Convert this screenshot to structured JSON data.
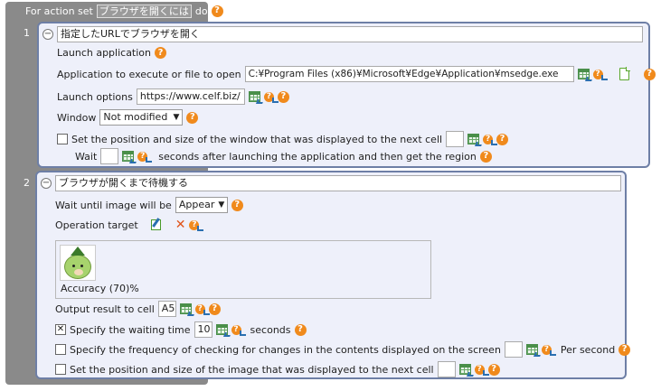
{
  "header": {
    "prefix": "For action set",
    "action_name": "ブラウザを開くには",
    "suffix": "do"
  },
  "step1": {
    "number": "1",
    "title": "指定したURLでブラウザを開く",
    "heading": "Launch application",
    "app_label": "Application to execute or file to open",
    "app_value": "C:¥Program Files (x86)¥Microsoft¥Edge¥Application¥msedge.exe",
    "options_label": "Launch options",
    "options_value": "https://www.celf.biz/",
    "window_label": "Window",
    "window_value": "Not modified",
    "set_position_label": "Set the position and size of the window that was displayed to the next cell",
    "wait_label": "Wait",
    "wait_suffix": "seconds after launching the application and then get the region"
  },
  "step2": {
    "number": "2",
    "title": "ブラウザが開くまで待機する",
    "wait_until_label": "Wait until image will be",
    "wait_until_value": "Appear",
    "operation_target_label": "Operation target",
    "accuracy_label": "Accuracy (70)%",
    "output_label": "Output result to cell",
    "output_value": "A5",
    "waiting_time_label": "Specify the waiting time",
    "waiting_time_value": "10",
    "waiting_time_unit": "seconds",
    "frequency_label": "Specify the frequency of checking for changes in the contents displayed on the screen",
    "frequency_unit": "Per second",
    "set_image_position_label": "Set the position and size of the image that was displayed to the next cell"
  },
  "help_glyph": "?",
  "icons": {
    "collapse": "minus-circle-icon",
    "cell_select": "spreadsheet-cell-icon",
    "help": "help-icon",
    "file": "file-browse-icon",
    "edit": "edit-image-icon",
    "delete": "delete-icon"
  },
  "colors": {
    "panel_bg": "#eef0fa",
    "panel_border": "#6e7fa6",
    "help": "#f08a1c"
  },
  "checkbox_states": {
    "set_position": false,
    "waiting_time": true,
    "frequency": false,
    "set_image_position": false
  }
}
